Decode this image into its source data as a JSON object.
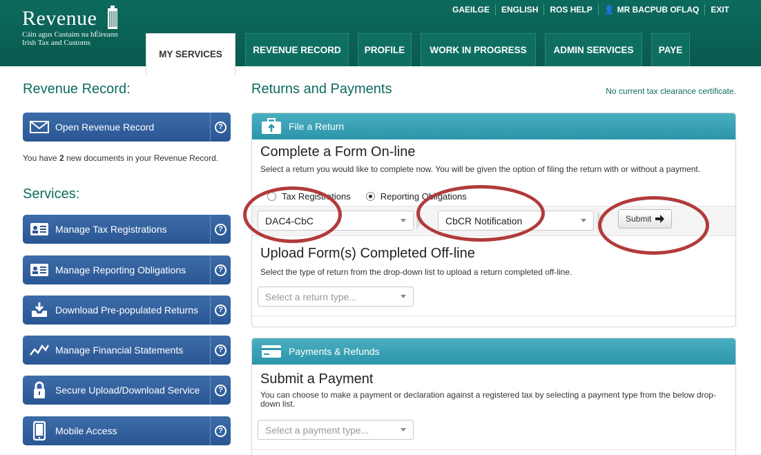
{
  "header": {
    "brand": "Revenue",
    "sub1": "Cáin agus Custaim na hÉireann",
    "sub2": "Irish Tax and Customs",
    "links": [
      "GAEILGE",
      "ENGLISH",
      "ROS HELP",
      "MR BACPUB OFLAQ",
      "EXIT"
    ],
    "tabs": [
      "MY SERVICES",
      "REVENUE RECORD",
      "PROFILE",
      "WORK IN PROGRESS",
      "ADMIN SERVICES",
      "PAYE"
    ]
  },
  "sidebar": {
    "revenue_record_title": "Revenue Record:",
    "open_record_label": "Open Revenue Record",
    "docs_text_a": "You have ",
    "docs_count": "2",
    "docs_text_b": " new documents in your Revenue Record.",
    "services_title": "Services:",
    "services": [
      {
        "label": "Manage Tax Registrations",
        "icon": "id-card-icon"
      },
      {
        "label": "Manage Reporting Obligations",
        "icon": "id-card-icon"
      },
      {
        "label": "Download Pre-populated Returns",
        "icon": "inbox-download-icon"
      },
      {
        "label": "Manage Financial Statements",
        "icon": "chart-line-icon"
      },
      {
        "label": "Secure Upload/Download Service",
        "icon": "padlock-icon"
      },
      {
        "label": "Mobile Access",
        "icon": "mobile-phone-icon"
      }
    ]
  },
  "main": {
    "title": "Returns and Payments",
    "clearance": "No current tax clearance certificate.",
    "file_return": {
      "header": "File a Return",
      "complete_title": "Complete a Form On-line",
      "complete_desc": "Select a return you would like to complete now. You will be given the option of filing the return with or without a payment.",
      "radio_tax": "Tax Registrations",
      "radio_reporting": "Reporting Obligations",
      "selected_radio": "Reporting Obligations",
      "select1_value": "DAC4-CbC",
      "select2_value": "CbCR Notification",
      "submit_label": "Submit",
      "upload_title": "Upload Form(s) Completed Off-line",
      "upload_desc": "Select the type of return from the drop-down list to upload a return completed off-line.",
      "upload_placeholder": "Select a return type..."
    },
    "payments": {
      "header": "Payments & Refunds",
      "title": "Submit a Payment",
      "desc": "You can choose to make a payment or declaration against a registered tax by selecting a payment type from the below drop-down list.",
      "placeholder": "Select a payment type..."
    }
  },
  "colors": {
    "brand_green": "#0a5a4f",
    "sidebar_blue": "#2a5694",
    "panel_teal": "#2c95aa",
    "highlight_ring": "#b23b3b"
  }
}
